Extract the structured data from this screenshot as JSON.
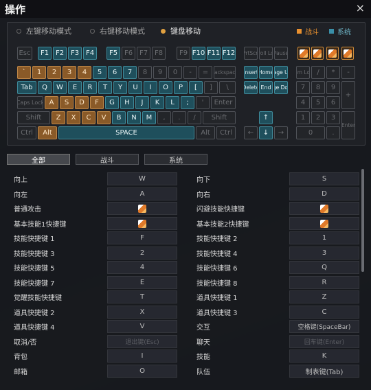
{
  "window": {
    "title": "操作",
    "close": "×"
  },
  "modes": [
    {
      "label": "左键移动模式",
      "selected": false
    },
    {
      "label": "右键移动模式",
      "selected": false
    },
    {
      "label": "键盘移动",
      "selected": true
    }
  ],
  "legend": [
    {
      "label": "战斗",
      "color": "#e8902f"
    },
    {
      "label": "系统",
      "color": "#3a8fa8"
    }
  ],
  "keyboard": {
    "row0": [
      "Esc",
      "F1",
      "F2",
      "F3",
      "F4",
      "F5",
      "F6",
      "F7",
      "F8",
      "F9",
      "F10",
      "F11",
      "F12",
      "PrtScn",
      "Scroll Lock",
      "Pause"
    ],
    "row1": [
      "`",
      "1",
      "2",
      "3",
      "4",
      "5",
      "6",
      "7",
      "8",
      "9",
      "0",
      "-",
      "=",
      "Backspace",
      "Insert",
      "Home",
      "Page Up",
      "Num Lock",
      "/",
      "*",
      "-"
    ],
    "row2": [
      "Tab",
      "Q",
      "W",
      "E",
      "R",
      "T",
      "Y",
      "U",
      "I",
      "O",
      "P",
      "[",
      "]",
      "\\",
      "Delete",
      "End",
      "Page Down",
      "7",
      "8",
      "9",
      "+"
    ],
    "row3": [
      "Caps Lock",
      "A",
      "S",
      "D",
      "F",
      "G",
      "H",
      "J",
      "K",
      "L",
      ";",
      "'",
      "Enter",
      "4",
      "5",
      "6"
    ],
    "row4": [
      "Shift",
      "Z",
      "X",
      "C",
      "V",
      "B",
      "N",
      "M",
      ",",
      ".",
      "/",
      "Shift",
      "↑",
      "1",
      "2",
      "3",
      "Enter"
    ],
    "row5": [
      "Ctrl",
      "Alt",
      "SPACE",
      "Alt",
      "Ctrl",
      "←",
      "↓",
      "→",
      "0",
      "."
    ]
  },
  "tabs": [
    {
      "label": "全部",
      "active": true
    },
    {
      "label": "战斗",
      "active": false
    },
    {
      "label": "系统",
      "active": false
    }
  ],
  "bindings": [
    {
      "left_label": "向上",
      "left_key": "W",
      "right_label": "向下",
      "right_key": "S"
    },
    {
      "left_label": "向左",
      "left_key": "A",
      "right_label": "向右",
      "right_key": "D"
    },
    {
      "left_label": "普通攻击",
      "left_key": "",
      "right_label": "闪避技能快捷键",
      "right_key": ""
    },
    {
      "left_label": "基本技能1快捷键",
      "left_key": "",
      "right_label": "基本技能2快捷键",
      "right_key": ""
    },
    {
      "left_label": "技能快捷键 1",
      "left_key": "F",
      "right_label": "技能快捷键 2",
      "right_key": "1"
    },
    {
      "left_label": "技能快捷键 3",
      "left_key": "2",
      "right_label": "技能快捷键 4",
      "right_key": "3"
    },
    {
      "left_label": "技能快捷键 5",
      "left_key": "4",
      "right_label": "技能快捷键 6",
      "right_key": "Q"
    },
    {
      "left_label": "技能快捷键 7",
      "left_key": "E",
      "right_label": "技能快捷键 8",
      "right_key": "R"
    },
    {
      "left_label": "觉醒技能快捷键",
      "left_key": "T",
      "right_label": "道具快捷键 1",
      "right_key": "Z"
    },
    {
      "left_label": "道具快捷键 2",
      "left_key": "X",
      "right_label": "道具快捷键 3",
      "right_key": "C"
    },
    {
      "left_label": "道具快捷键 4",
      "left_key": "V",
      "right_label": "交互",
      "right_key": "空格键(SpaceBar)"
    },
    {
      "left_label": "取消/否",
      "left_key": "退出键(Esc)",
      "right_label": "聊天",
      "right_key": "回车键(Enter)"
    },
    {
      "left_label": "背包",
      "left_key": "I",
      "right_label": "技能",
      "right_key": "K"
    },
    {
      "left_label": "邮箱",
      "left_key": "O",
      "right_label": "队伍",
      "right_key": "制表键(Tab)"
    }
  ]
}
